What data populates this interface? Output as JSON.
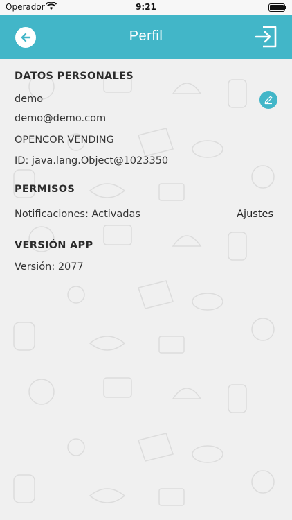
{
  "status_bar": {
    "carrier": "Operador",
    "time": "9:21"
  },
  "header": {
    "title": "Perfil",
    "back_icon": "arrow-left-icon",
    "logout_icon": "logout-icon",
    "background_color": "#42b6c8"
  },
  "personal_data": {
    "title": "DATOS PERSONALES",
    "name": "demo",
    "email": "demo@demo.com",
    "company": "OPENCOR VENDING",
    "id": "ID: java.lang.Object@1023350",
    "edit_icon": "pencil-icon"
  },
  "permissions": {
    "title": "PERMISOS",
    "notifications": "Notificaciones: Activadas",
    "settings_link": "Ajustes"
  },
  "app_version": {
    "title": "VERSIÓN APP",
    "version": "Versión: 2077"
  }
}
